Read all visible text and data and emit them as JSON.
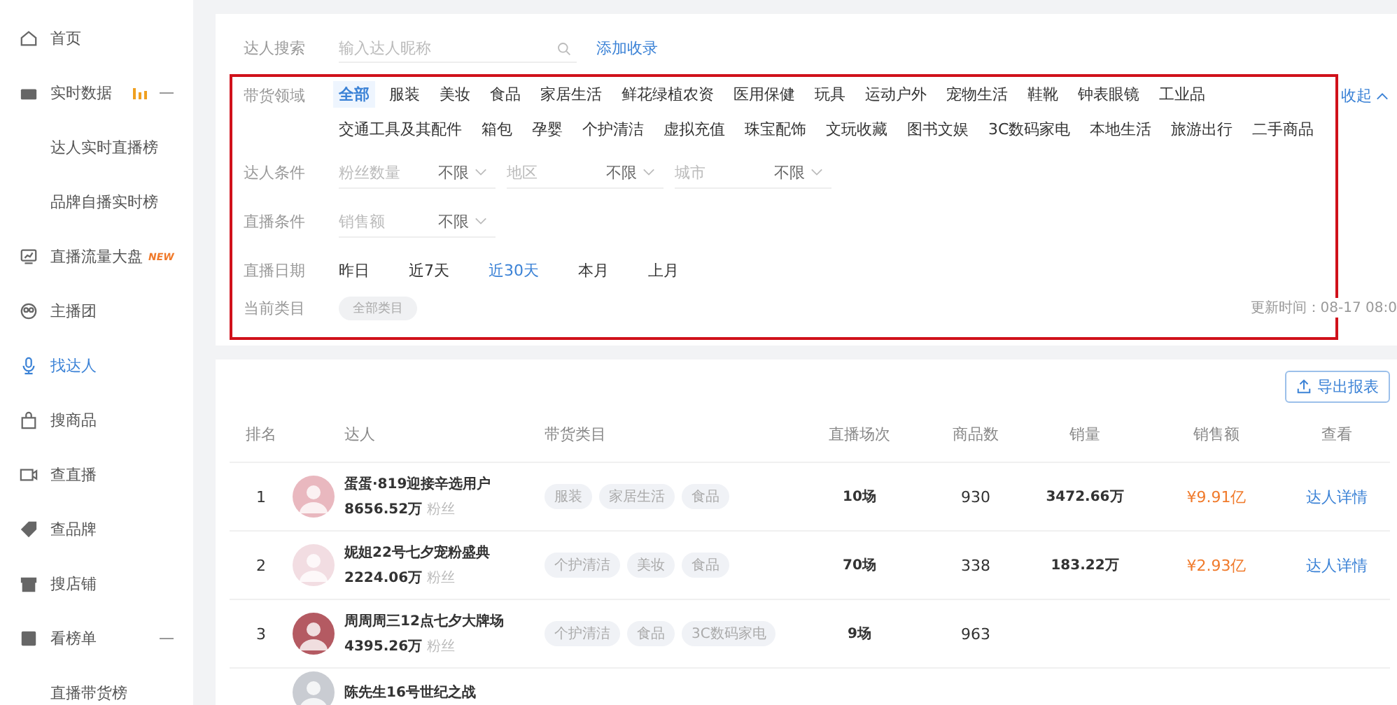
{
  "sidebar": {
    "items": [
      {
        "label": "首页",
        "selected": false
      },
      {
        "label": "实时数据",
        "selected": false,
        "live": true,
        "expanded": true,
        "children": [
          {
            "label": "达人实时直播榜",
            "selected": false
          },
          {
            "label": "品牌自播实时榜",
            "selected": false
          }
        ]
      },
      {
        "label": "直播流量大盘",
        "selected": false,
        "badge": "NEW"
      },
      {
        "label": "主播团",
        "selected": false
      },
      {
        "label": "找达人",
        "selected": true
      },
      {
        "label": "搜商品",
        "selected": false
      },
      {
        "label": "查直播",
        "selected": false
      },
      {
        "label": "查品牌",
        "selected": false
      },
      {
        "label": "搜店铺",
        "selected": false
      },
      {
        "label": "看榜单",
        "selected": false,
        "expanded": true,
        "children": [
          {
            "label": "直播带货榜",
            "selected": false
          }
        ]
      }
    ]
  },
  "search": {
    "label": "达人搜索",
    "placeholder": "输入达人昵称",
    "link": "添加收录"
  },
  "category": {
    "label": "带货领域",
    "toggle": "收起",
    "options": [
      {
        "label": "全部",
        "selected": true
      },
      {
        "label": "服装",
        "selected": false
      },
      {
        "label": "美妆",
        "selected": false
      },
      {
        "label": "食品",
        "selected": false
      },
      {
        "label": "家居生活",
        "selected": false
      },
      {
        "label": "鲜花绿植农资",
        "selected": false
      },
      {
        "label": "医用保健",
        "selected": false
      },
      {
        "label": "玩具",
        "selected": false
      },
      {
        "label": "运动户外",
        "selected": false
      },
      {
        "label": "宠物生活",
        "selected": false
      },
      {
        "label": "鞋靴",
        "selected": false
      },
      {
        "label": "钟表眼镜",
        "selected": false
      },
      {
        "label": "工业品",
        "selected": false
      },
      {
        "label": "交通工具及其配件",
        "selected": false
      },
      {
        "label": "箱包",
        "selected": false
      },
      {
        "label": "孕婴",
        "selected": false
      },
      {
        "label": "个护清洁",
        "selected": false
      },
      {
        "label": "虚拟充值",
        "selected": false
      },
      {
        "label": "珠宝配饰",
        "selected": false
      },
      {
        "label": "文玩收藏",
        "selected": false
      },
      {
        "label": "图书文娱",
        "selected": false
      },
      {
        "label": "3C数码家电",
        "selected": false
      },
      {
        "label": "本地生活",
        "selected": false
      },
      {
        "label": "旅游出行",
        "selected": false
      },
      {
        "label": "二手商品",
        "selected": false
      }
    ]
  },
  "conditions": [
    {
      "label": "达人条件",
      "selects": [
        {
          "placeholder": "粉丝数量",
          "value": "不限"
        },
        {
          "placeholder": "地区",
          "value": "不限"
        },
        {
          "placeholder": "城市",
          "value": "不限"
        }
      ]
    },
    {
      "label": "直播条件",
      "selects": [
        {
          "placeholder": "销售额",
          "value": "不限"
        }
      ]
    }
  ],
  "date": {
    "label": "直播日期",
    "options": [
      {
        "label": "昨日",
        "selected": false
      },
      {
        "label": "近7天",
        "selected": false
      },
      {
        "label": "近30天",
        "selected": true
      },
      {
        "label": "本月",
        "selected": false
      },
      {
        "label": "上月",
        "selected": false
      }
    ]
  },
  "current": {
    "label": "当前类目",
    "tags": [
      "全部类目"
    ]
  },
  "update_time": "更新时间：08-17 08:0",
  "table": {
    "export": "导出报表",
    "columns": [
      "排名",
      "达人",
      "带货类目",
      "直播场次",
      "商品数",
      "销量",
      "销售额",
      "查看"
    ],
    "rows": [
      {
        "rank": "1",
        "name": "蛋蛋·819迎接辛选用户",
        "fans": "8656.52万",
        "fans_unit": "粉丝",
        "tags": [
          "服装",
          "家居生活",
          "食品"
        ],
        "sessions": "10场",
        "products": "930",
        "sales": "3472.66万",
        "revenue": "¥9.91亿",
        "link": "达人详情"
      },
      {
        "rank": "2",
        "name": "妮姐22号七夕宠粉盛典",
        "fans": "2224.06万",
        "fans_unit": "粉丝",
        "tags": [
          "个护清洁",
          "美妆",
          "食品"
        ],
        "sessions": "70场",
        "products": "338",
        "sales": "183.22万",
        "revenue": "¥2.93亿",
        "link": "达人详情"
      },
      {
        "rank": "3",
        "name": "周周周三12点七夕大牌场",
        "fans": "4395.26万",
        "fans_unit": "粉丝",
        "tags": [
          "个护清洁",
          "食品",
          "3C数码家电"
        ],
        "sessions": "9场",
        "products": "963"
      },
      {
        "name": "陈先生16号世纪之战"
      }
    ]
  }
}
